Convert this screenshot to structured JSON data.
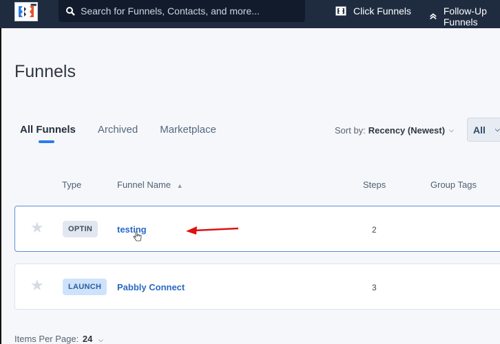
{
  "topbar": {
    "search_placeholder": "Search for Funnels, Contacts, and more...",
    "nav": [
      {
        "label": "Click Funnels",
        "icon": "clickfunnels-icon"
      },
      {
        "label": "Follow-Up Funnels",
        "icon": "double-chevron-up-icon"
      }
    ]
  },
  "page": {
    "title": "Funnels",
    "tabs": [
      {
        "label": "All Funnels",
        "active": true
      },
      {
        "label": "Archived",
        "active": false
      },
      {
        "label": "Marketplace",
        "active": false
      }
    ],
    "sort": {
      "label": "Sort by:",
      "value": "Recency (Newest)"
    },
    "filter": {
      "value": "All"
    }
  },
  "table": {
    "columns": {
      "type": "Type",
      "name": "Funnel Name",
      "steps": "Steps",
      "tags": "Group Tags"
    },
    "rows": [
      {
        "type": "OPTIN",
        "name": "testing",
        "steps": "2"
      },
      {
        "type": "LAUNCH",
        "name": "Pabbly Connect",
        "steps": "3"
      }
    ]
  },
  "footer": {
    "label": "Items Per Page:",
    "value": "24"
  },
  "colors": {
    "topbar": "#1f2c40",
    "accent": "#2a7ce8",
    "link": "#2769c4",
    "annotation_arrow": "#e01010"
  }
}
